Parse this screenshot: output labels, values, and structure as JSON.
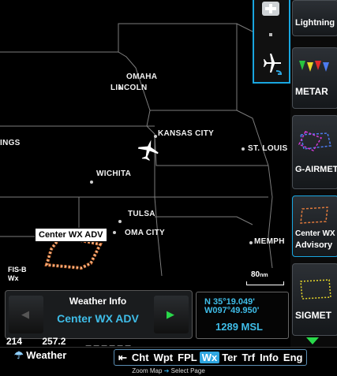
{
  "map": {
    "cities": {
      "omaha": "OMAHA",
      "lincoln": "LINCOLN",
      "kansas_city": "KANSAS CITY",
      "st_louis": "ST. LOUIS",
      "wichita": "WICHITA",
      "tulsa": "TULSA",
      "okc": "OMA CITY",
      "memphis": "MEMPH",
      "springs": "INGS"
    },
    "selected_label": "Center WX ADV",
    "fisb": "FIS-B",
    "fisb_sub": "Wx",
    "scale": "80",
    "scale_unit": "nm"
  },
  "right_panel": {
    "lightning": "Lightning",
    "metar": "METAR",
    "g_airmet": "G-AIRMET",
    "center_wx_1": "Center WX",
    "center_wx_2": "Advisory",
    "sigmet": "SIGMET"
  },
  "weather_info": {
    "title": "Weather Info",
    "value": "Center WX ADV"
  },
  "position": {
    "lat": "N  35°19.049'",
    "lon": "W097°49.950'",
    "altitude": "1289",
    "alt_unit": "MSL"
  },
  "readout": {
    "track": "214",
    "distance": "257.2",
    "blank": "_ _ _ _ _ _"
  },
  "page_button": "Weather",
  "tabs": [
    "Cht",
    "Wpt",
    "FPL",
    "Wx",
    "Ter",
    "Trf",
    "Info",
    "Eng"
  ],
  "active_tab": "Wx",
  "hint": {
    "left": "Zoom Map",
    "right": "Select Page"
  },
  "colors": {
    "accent": "#2fa6e0",
    "cyan_text": "#3fbde8",
    "green_arrow": "#29d94a"
  }
}
